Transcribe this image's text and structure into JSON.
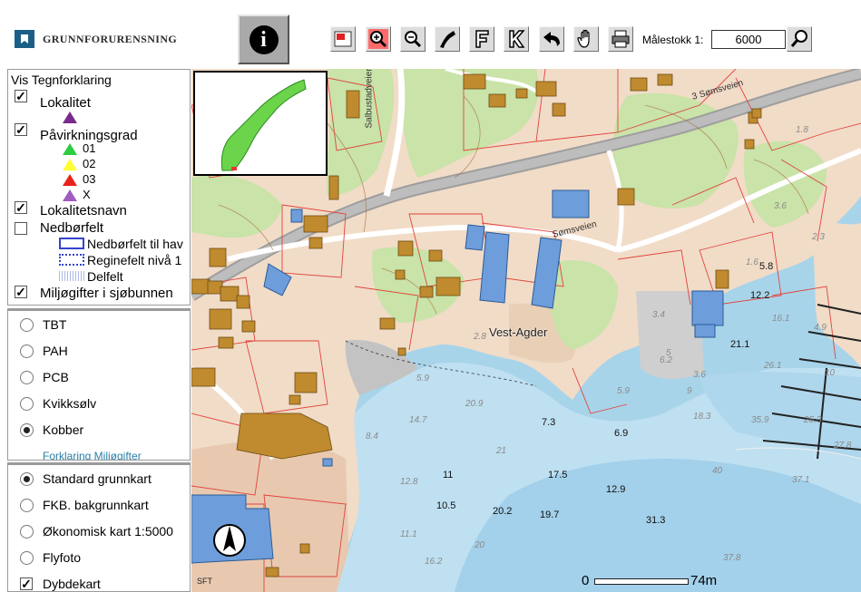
{
  "header": {
    "logo_text": "GRUNNFORURENSNING",
    "scale_label": "Målestokk 1:",
    "scale_value": "6000",
    "tools": [
      "info-icon",
      "overview-icon",
      "zoom-in-icon",
      "zoom-out-icon",
      "measure-icon",
      "f-icon",
      "k-icon",
      "back-icon",
      "pan-hand-icon",
      "print-icon",
      "search-icon"
    ]
  },
  "legend": {
    "title": "Vis Tegnforklaring",
    "lokalitet": {
      "label": "Lokalitet",
      "checked": true
    },
    "paavirkning": {
      "label": "Påvirkningsgrad",
      "checked": true,
      "grades": [
        {
          "label": "01",
          "color": "#2ecc40"
        },
        {
          "label": "02",
          "color": "#ffff33"
        },
        {
          "label": "03",
          "color": "#e8231a"
        },
        {
          "label": "X",
          "color": "#a05cc0"
        }
      ]
    },
    "lokalitetsnavn": {
      "label": "Lokalitetsnavn",
      "checked": true
    },
    "nedborfelt": {
      "label": "Nedbørfelt",
      "checked": false,
      "items": [
        "Nedbørfelt til hav",
        "Reginefelt nivå 1",
        "Delfelt"
      ]
    },
    "miljogifter": {
      "label": "Miljøgifter i sjøbunnen",
      "checked": true
    }
  },
  "pollutants": {
    "options": [
      "TBT",
      "PAH",
      "PCB",
      "Kvikksølv",
      "Kobber"
    ],
    "selected": "Kobber",
    "link": "Forklaring Miljøgifter"
  },
  "basemaps": {
    "options": [
      "Standard grunnkart",
      "FKB. bakgrunnkart",
      "Økonomisk kart 1:5000",
      "Flyfoto",
      "Dybdekart"
    ],
    "selected": "Standard grunnkart",
    "dybdekart_checked": true
  },
  "map": {
    "place_name": "Vest-Agder",
    "roads": [
      "3 Sømsveien",
      "Sømsveien",
      "Salbustadveien"
    ],
    "depths_bold": [
      "5.8",
      "12.2",
      "21.1",
      "7.3",
      "6.9",
      "11",
      "17.5",
      "12.9",
      "10.5",
      "20.2",
      "19.7",
      "31.3"
    ],
    "depths_italic": [
      "1.8",
      "3.6",
      "2.3",
      "1.6",
      "16.1",
      "4.9",
      "26.1",
      "10",
      "35.9",
      "25.3",
      "27.8",
      "40",
      "37.1",
      "37.8",
      "3.4",
      "6.2",
      "3.6",
      "9",
      "5",
      "18.3",
      "5.9",
      "20.9",
      "14.7",
      "8.4",
      "21",
      "12.8",
      "11.1",
      "16.2",
      "20",
      "2.8",
      "5.9"
    ],
    "scalebar_start": "0",
    "scalebar_end": "74m",
    "corner_label": "SFT"
  }
}
